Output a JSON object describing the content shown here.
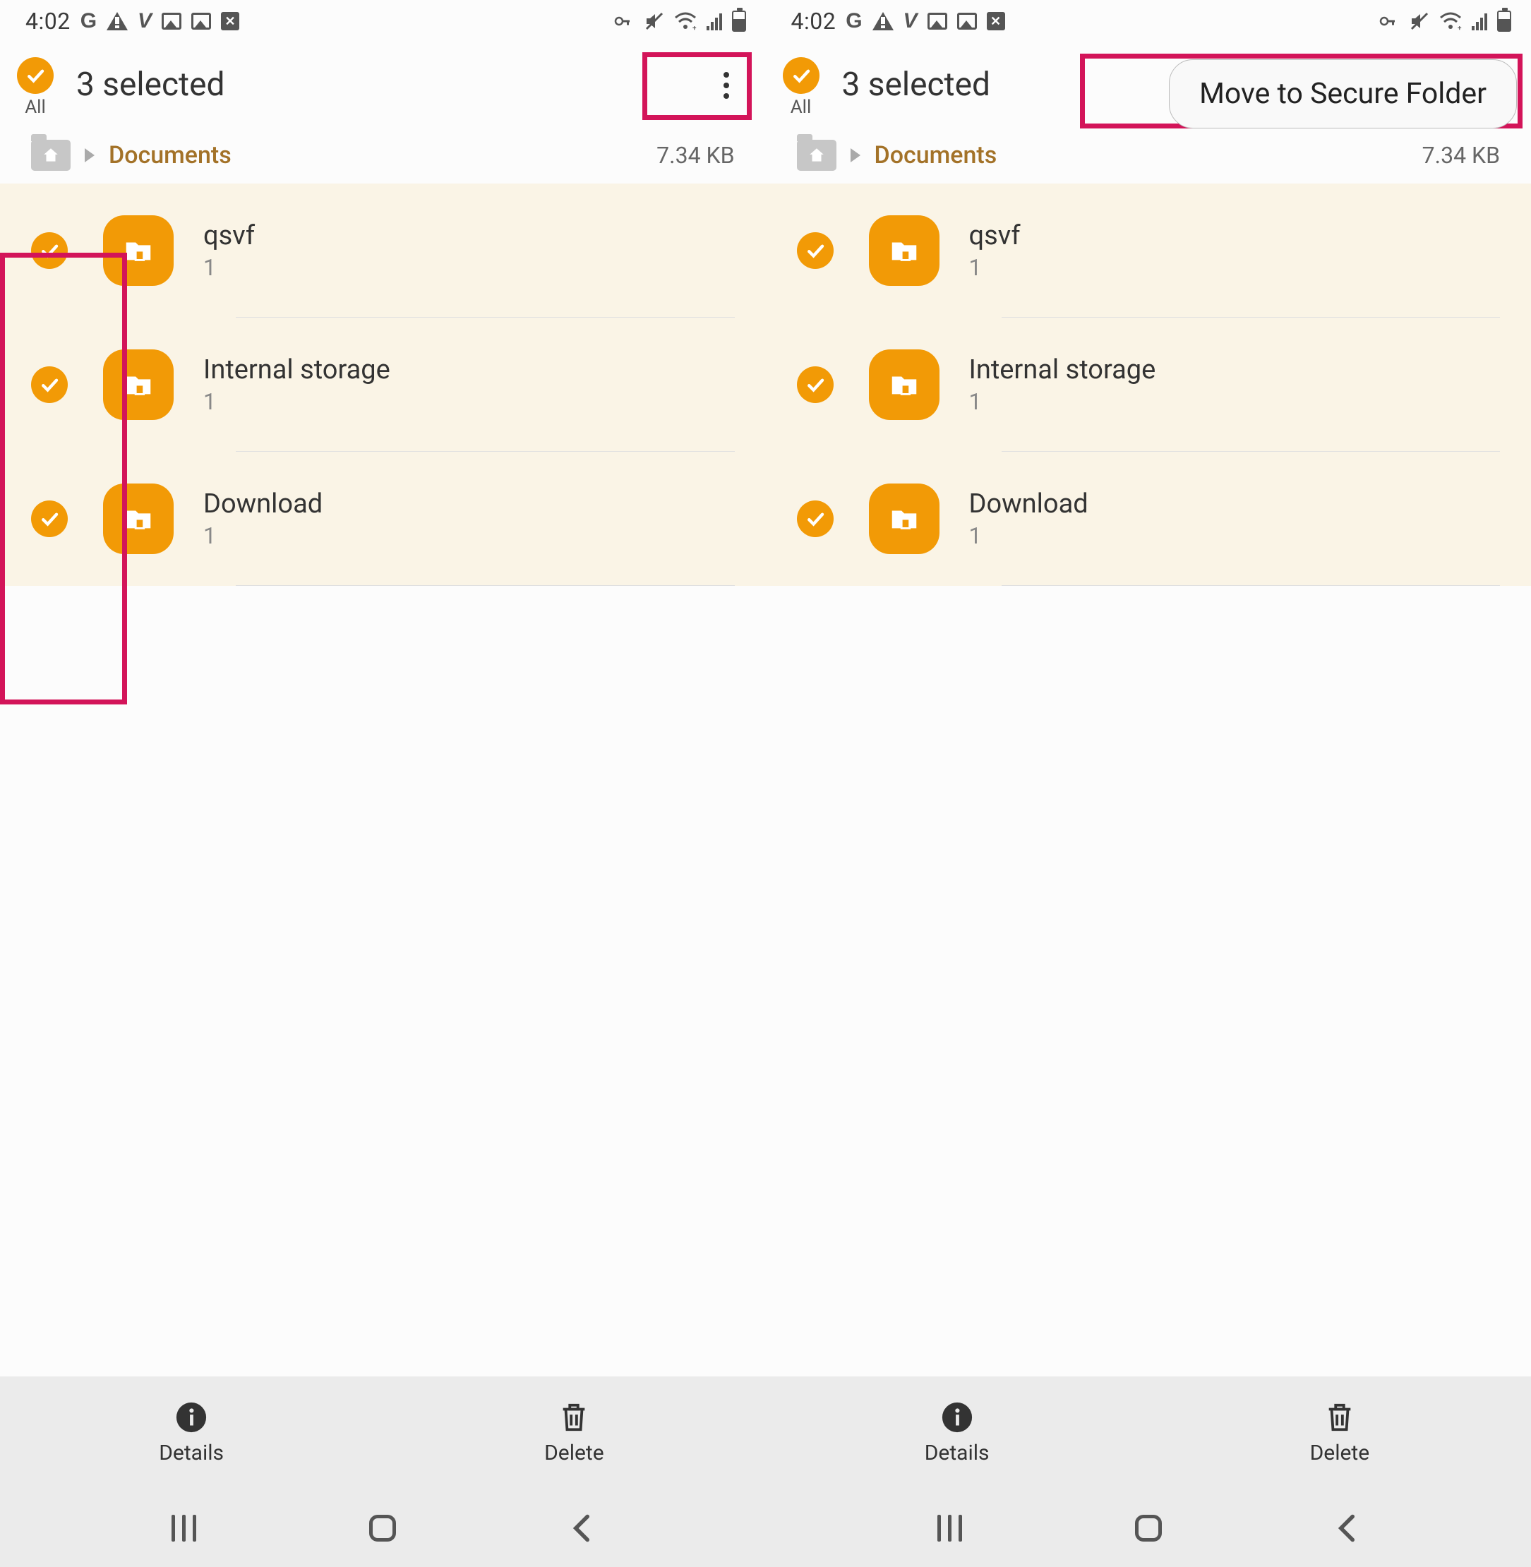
{
  "status": {
    "time": "4:02"
  },
  "header": {
    "title": "3 selected",
    "all": "All"
  },
  "breadcrumb": {
    "label": "Documents",
    "size": "7.34 KB"
  },
  "popup": {
    "move_secure": "Move to Secure Folder"
  },
  "files": [
    {
      "name": "qsvf",
      "sub": "1"
    },
    {
      "name": "Internal storage",
      "sub": "1"
    },
    {
      "name": "Download",
      "sub": "1"
    }
  ],
  "actions": {
    "details": "Details",
    "delete": "Delete"
  }
}
